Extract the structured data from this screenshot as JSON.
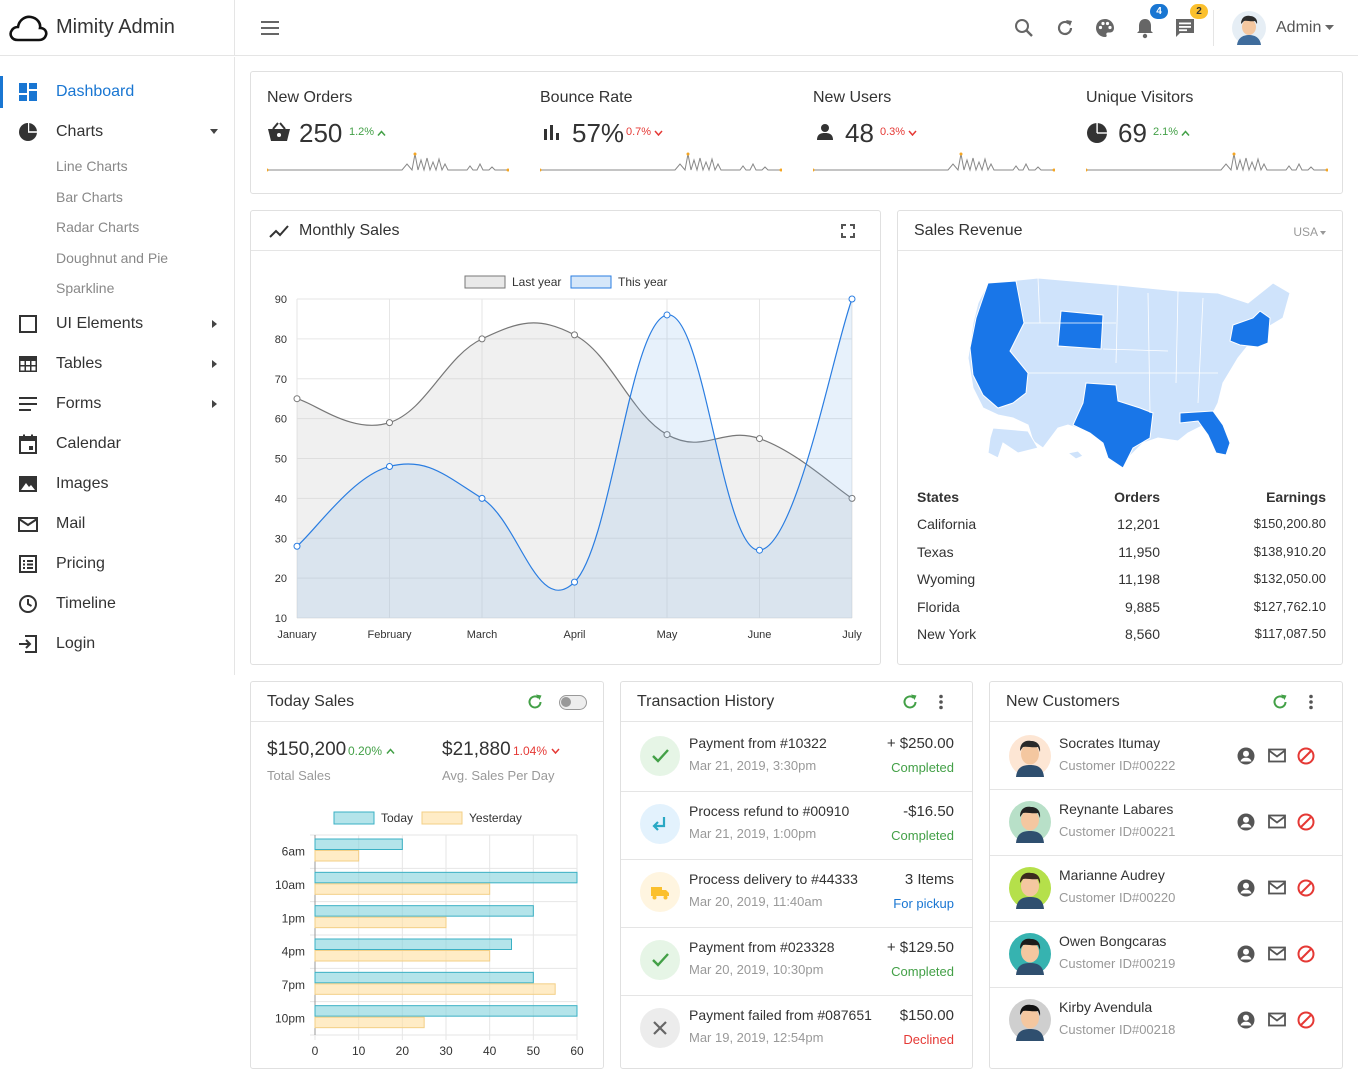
{
  "brand": {
    "name": "Mimity Admin"
  },
  "header": {
    "user_name": "Admin",
    "notifications_count": "4",
    "messages_count": "2"
  },
  "sidebar": {
    "items": [
      {
        "label": "Dashboard",
        "icon": "dashboard-icon"
      },
      {
        "label": "Charts",
        "icon": "pie-chart-icon"
      },
      {
        "label": "UI Elements",
        "icon": "square-icon"
      },
      {
        "label": "Tables",
        "icon": "table-icon"
      },
      {
        "label": "Forms",
        "icon": "forms-icon"
      },
      {
        "label": "Calendar",
        "icon": "calendar-icon"
      },
      {
        "label": "Images",
        "icon": "image-icon"
      },
      {
        "label": "Mail",
        "icon": "mail-icon"
      },
      {
        "label": "Pricing",
        "icon": "pricing-icon"
      },
      {
        "label": "Timeline",
        "icon": "clock-icon"
      },
      {
        "label": "Login",
        "icon": "login-icon"
      }
    ],
    "chart_sub": [
      "Line Charts",
      "Bar Charts",
      "Radar Charts",
      "Doughnut and Pie",
      "Sparkline"
    ]
  },
  "stats": [
    {
      "title": "New Orders",
      "value": "250",
      "delta": "1.2%",
      "trend": "up"
    },
    {
      "title": "Bounce Rate",
      "value": "57%",
      "delta": "0.7%",
      "trend": "down"
    },
    {
      "title": "New Users",
      "value": "48",
      "delta": "0.3%",
      "trend": "down"
    },
    {
      "title": "Unique Visitors",
      "value": "69",
      "delta": "2.1%",
      "trend": "up"
    }
  ],
  "monthly_sales": {
    "title": "Monthly Sales"
  },
  "sales_revenue": {
    "title": "Sales Revenue",
    "country": "USA",
    "headers": {
      "state": "States",
      "orders": "Orders",
      "earnings": "Earnings"
    },
    "rows": [
      {
        "state": "California",
        "orders": "12,201",
        "earnings": "$150,200.80"
      },
      {
        "state": "Texas",
        "orders": "11,950",
        "earnings": "$138,910.20"
      },
      {
        "state": "Wyoming",
        "orders": "11,198",
        "earnings": "$132,050.00"
      },
      {
        "state": "Florida",
        "orders": "9,885",
        "earnings": "$127,762.10"
      },
      {
        "state": "New York",
        "orders": "8,560",
        "earnings": "$117,087.50"
      }
    ]
  },
  "today_sales": {
    "title": "Today Sales",
    "total_value": "$150,200",
    "total_delta": "0.20%",
    "total_label": "Total Sales",
    "avg_value": "$21,880",
    "avg_delta": "1.04%",
    "avg_label": "Avg. Sales Per Day"
  },
  "transactions": {
    "title": "Transaction History",
    "items": [
      {
        "title": "Payment from #10322",
        "date": "Mar 21, 2019, 3:30pm",
        "amount": "+ $250.00",
        "status": "Completed",
        "kind": "check-icon"
      },
      {
        "title": "Process refund to #00910",
        "date": "Mar 21, 2019, 1:00pm",
        "amount": "-$16.50",
        "status": "Completed",
        "kind": "refund-icon"
      },
      {
        "title": "Process delivery to #44333",
        "date": "Mar 20, 2019, 11:40am",
        "amount": "3 Items",
        "status": "For pickup",
        "kind": "truck-icon"
      },
      {
        "title": "Payment from #023328",
        "date": "Mar 20, 2019, 10:30pm",
        "amount": "+ $129.50",
        "status": "Completed",
        "kind": "check-icon"
      },
      {
        "title": "Payment failed from #087651",
        "date": "Mar 19, 2019, 12:54pm",
        "amount": "$150.00",
        "status": "Declined",
        "kind": "close-icon"
      }
    ]
  },
  "customers": {
    "title": "New Customers",
    "items": [
      {
        "name": "Socrates Itumay",
        "id": "Customer ID#00222"
      },
      {
        "name": "Reynante Labares",
        "id": "Customer ID#00221"
      },
      {
        "name": "Marianne Audrey",
        "id": "Customer ID#00220"
      },
      {
        "name": "Owen Bongcaras",
        "id": "Customer ID#00219"
      },
      {
        "name": "Kirby Avendula",
        "id": "Customer ID#00218"
      }
    ]
  },
  "colors": {
    "accent": "#1976d2",
    "up": "#43a047",
    "down": "#e53935",
    "map_light": "#cfe3fb",
    "map_dark": "#1976e8"
  },
  "chart_data": [
    {
      "type": "line",
      "categories": [
        "January",
        "February",
        "March",
        "April",
        "May",
        "June",
        "July"
      ],
      "series": [
        {
          "name": "Last year",
          "values": [
            65,
            59,
            80,
            81,
            56,
            55,
            40
          ]
        },
        {
          "name": "This year",
          "values": [
            28,
            48,
            40,
            19,
            86,
            27,
            90
          ]
        }
      ],
      "ylim": [
        10,
        90
      ],
      "yticks": [
        10,
        20,
        30,
        40,
        50,
        60,
        70,
        80,
        90
      ],
      "grid": true,
      "legend": "top"
    },
    {
      "type": "bar",
      "orientation": "horizontal",
      "categories": [
        "6am",
        "10am",
        "1pm",
        "4pm",
        "7pm",
        "10pm"
      ],
      "series": [
        {
          "name": "Today",
          "values": [
            20,
            60,
            50,
            45,
            50,
            60
          ]
        },
        {
          "name": "Yesterday",
          "values": [
            10,
            40,
            30,
            40,
            55,
            25
          ]
        }
      ],
      "xlim": [
        0,
        60
      ],
      "xticks": [
        0,
        10,
        20,
        30,
        40,
        50,
        60
      ],
      "grid": true,
      "legend": "top"
    }
  ]
}
